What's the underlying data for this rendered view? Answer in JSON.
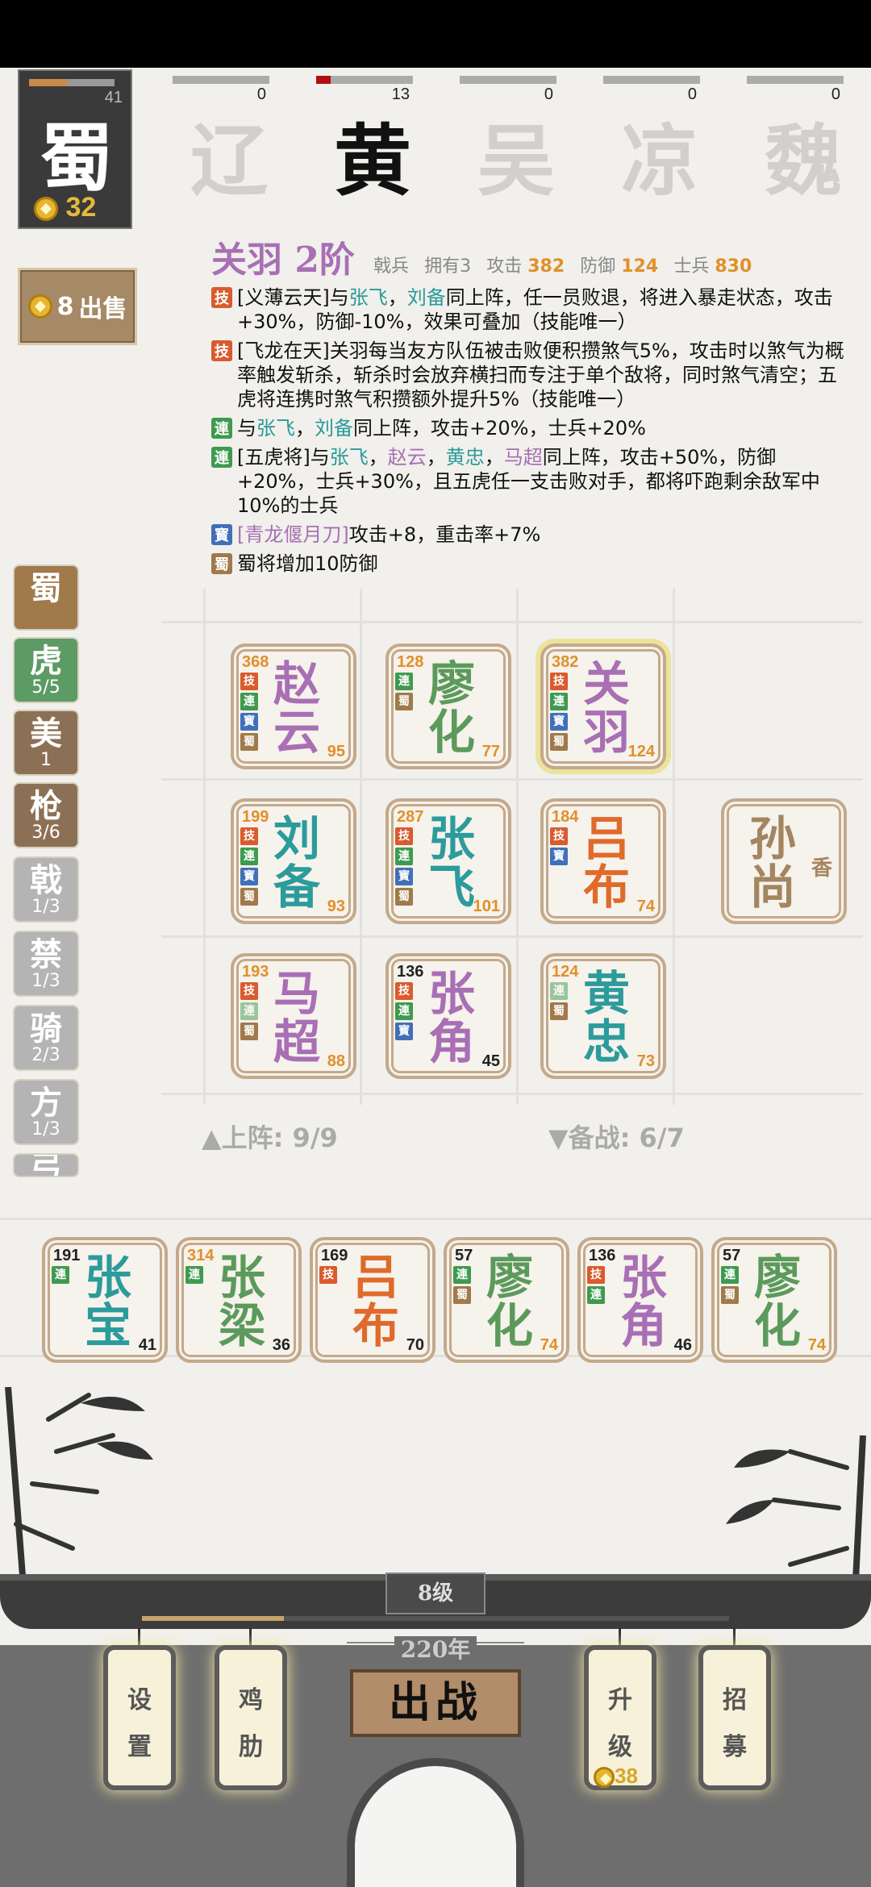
{
  "faction": {
    "name": "蜀",
    "count": "41",
    "gold": "32"
  },
  "rivals": [
    {
      "name": "辽",
      "score": "0"
    },
    {
      "name": "黄",
      "score": "13"
    },
    {
      "name": "吴",
      "score": "0"
    },
    {
      "name": "凉",
      "score": "0"
    },
    {
      "name": "魏",
      "score": "0"
    }
  ],
  "sell": {
    "price": "8",
    "label": "出售"
  },
  "hero": {
    "title": "关羽 2阶",
    "type": "戟兵",
    "owned": "拥有3",
    "attack_label": "攻击",
    "attack": "382",
    "defense_label": "防御",
    "defense": "124",
    "troops_label": "士兵",
    "troops": "830"
  },
  "skills": [
    {
      "tag": "技",
      "p1": "[义薄云天]与",
      "a": "张飞",
      "p2": "，",
      "b": "刘备",
      "p3": "同上阵，任一员败退，将进入暴走状态，攻击+30%，防御-10%，效果可叠加（技能唯一）"
    },
    {
      "tag": "技",
      "text": "[飞龙在天]关羽每当友方队伍被击败便积攒煞气5%，攻击时以煞气为概率触发斩杀，斩杀时会放弃横扫而专注于单个敌将，同时煞气清空；五虎将连携时煞气积攒额外提升5%（技能唯一）"
    },
    {
      "tag": "連",
      "p1": "与",
      "a": "张飞",
      "p2": "，",
      "b": "刘备",
      "p3": "同上阵，攻击+20%，士兵+20%"
    },
    {
      "tag": "連",
      "p1": "[五虎将]与",
      "a": "张飞",
      "p2": "，",
      "b": "赵云",
      "p3": "，",
      "c": "黄忠",
      "p4": "，",
      "d": "马超",
      "p5": "同上阵，攻击+50%，防御+20%，士兵+30%，且五虎任一支击败对手，都将吓跑剩余敌军中10%的士兵"
    },
    {
      "tag": "寳",
      "a": "[青龙偃月刀]",
      "p1": "攻击+8，重击率+7%"
    },
    {
      "tag": "蜀",
      "p1": "蜀将增加10防御"
    }
  ],
  "filters": [
    {
      "label": "蜀",
      "count": ""
    },
    {
      "label": "虎",
      "count": "5/5"
    },
    {
      "label": "美",
      "count": "1"
    },
    {
      "label": "枪",
      "count": "3/6"
    },
    {
      "label": "戟",
      "count": "1/3"
    },
    {
      "label": "禁",
      "count": "1/3"
    },
    {
      "label": "骑",
      "count": "2/3"
    },
    {
      "label": "方",
      "count": "1/3"
    },
    {
      "label": "弓",
      "count": ""
    }
  ],
  "board": [
    {
      "hp": "368",
      "n1": "赵",
      "n2": "云",
      "atk": "95",
      "tags": [
        "技",
        "連",
        "寳",
        "蜀"
      ]
    },
    {
      "hp": "128",
      "n1": "廖",
      "n2": "化",
      "atk": "77",
      "tags": [
        "連",
        "蜀"
      ]
    },
    {
      "hp": "382",
      "n1": "关",
      "n2": "羽",
      "atk": "124",
      "tags": [
        "技",
        "連",
        "寳",
        "蜀"
      ]
    },
    {
      "hp": "199",
      "n1": "刘",
      "n2": "备",
      "atk": "93",
      "tags": [
        "技",
        "連",
        "寳",
        "蜀"
      ]
    },
    {
      "hp": "287",
      "n1": "张",
      "n2": "飞",
      "atk": "101",
      "tags": [
        "技",
        "連",
        "寳",
        "蜀"
      ]
    },
    {
      "hp": "184",
      "n1": "吕",
      "n2": "布",
      "atk": "74",
      "tags": [
        "技",
        "寳"
      ]
    },
    {
      "n1": "孙",
      "n2": "尚",
      "extra": "香"
    },
    {
      "hp": "193",
      "n1": "马",
      "n2": "超",
      "atk": "88",
      "tags": [
        "技",
        "連",
        "蜀"
      ]
    },
    {
      "hp": "136",
      "n1": "张",
      "n2": "角",
      "atk": "45",
      "tags": [
        "技",
        "連",
        "寳"
      ]
    },
    {
      "hp": "124",
      "n1": "黄",
      "n2": "忠",
      "atk": "73",
      "tags": [
        "連",
        "蜀"
      ]
    }
  ],
  "deploy": "上阵: 9/9",
  "reserve": "备战: 6/7",
  "bench": [
    {
      "hp": "191",
      "n1": "张",
      "n2": "宝",
      "atk": "41",
      "tags": [
        "連"
      ]
    },
    {
      "hp": "314",
      "n1": "张",
      "n2": "梁",
      "atk": "36",
      "tags": [
        "連"
      ]
    },
    {
      "hp": "169",
      "n1": "吕",
      "n2": "布",
      "atk": "70",
      "tags": [
        "技"
      ]
    },
    {
      "hp": "57",
      "n1": "廖",
      "n2": "化",
      "atk": "74",
      "tags": [
        "連",
        "蜀"
      ]
    },
    {
      "hp": "136",
      "n1": "张",
      "n2": "角",
      "atk": "46",
      "tags": [
        "技",
        "連"
      ]
    },
    {
      "hp": "57",
      "n1": "廖",
      "n2": "化",
      "atk": "74",
      "tags": [
        "連",
        "蜀"
      ]
    }
  ],
  "bottom": {
    "level": "8级",
    "year": "220年",
    "settings": "设置",
    "chicken": "鸡肋",
    "battle": "出战",
    "upgrade": "升级",
    "upgrade_cost": "38",
    "recruit": "招募"
  },
  "colors": {
    "accent": "#a86fb5",
    "gold": "#e0902a",
    "teal": "#2a9a9a"
  }
}
